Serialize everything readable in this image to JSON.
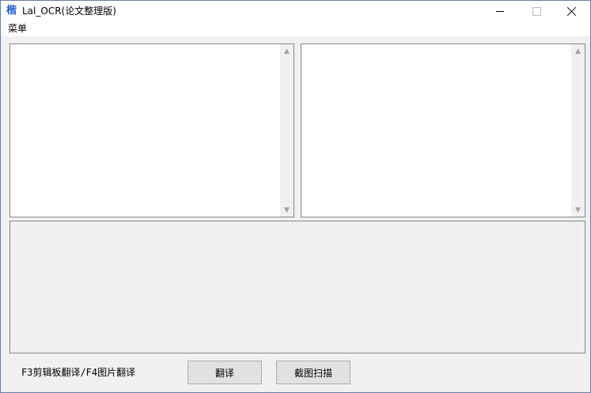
{
  "window": {
    "title": "Lal_OCR(论文整理版)",
    "app_icon_glyph": "楷"
  },
  "caption_buttons": {
    "minimize": "minimize-icon",
    "maximize": "maximize-icon",
    "close": "close-icon"
  },
  "menubar": {
    "items": [
      {
        "label": "菜单"
      }
    ]
  },
  "scroll_arrows": {
    "up": "▲",
    "down": "▼"
  },
  "footer": {
    "hint": "F3剪辑板翻译/F4图片翻译",
    "translate_label": "翻译",
    "capture_label": "截图扫描"
  }
}
